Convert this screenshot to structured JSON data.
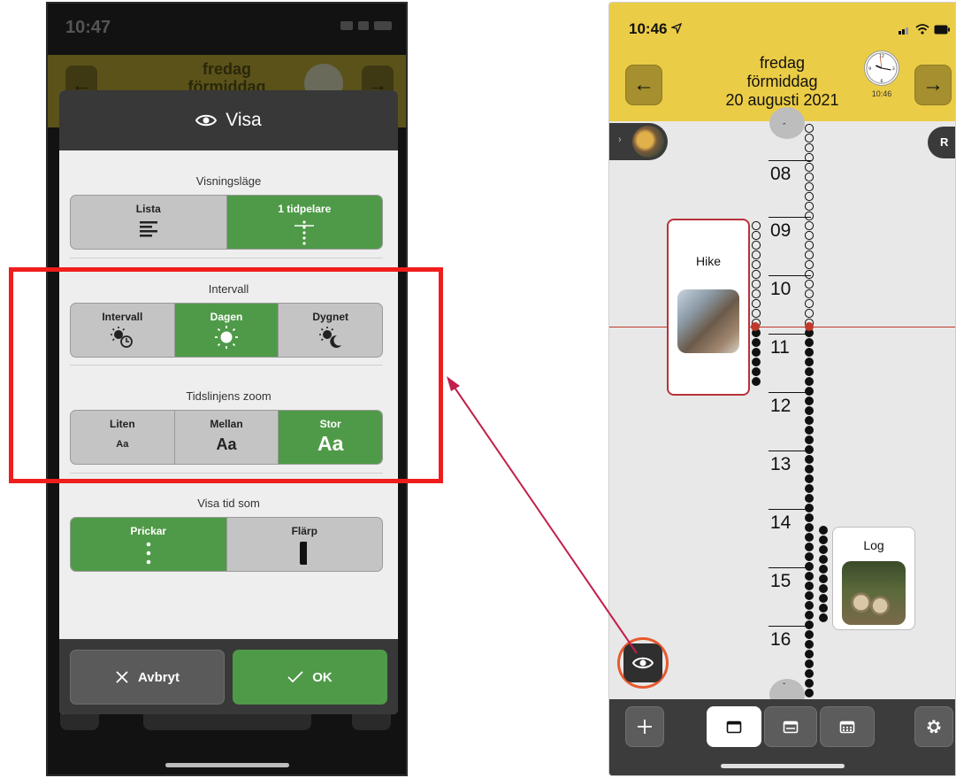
{
  "left_phone": {
    "status_time": "10:47",
    "header_title_line1": "fredag",
    "header_title_line2": "förmiddag",
    "dialog": {
      "title": "Visa",
      "title_icon": "eye-icon",
      "sections": [
        {
          "title": "Visningsläge",
          "options": [
            {
              "label": "Lista",
              "icon": "list-icon",
              "active": false
            },
            {
              "label": "1 tidpelare",
              "icon": "timepillar-icon",
              "active": true
            }
          ]
        },
        {
          "title": "Intervall",
          "options": [
            {
              "label": "Intervall",
              "icon": "sun-clock-icon",
              "active": false
            },
            {
              "label": "Dagen",
              "icon": "sun-icon",
              "active": true
            },
            {
              "label": "Dygnet",
              "icon": "sun-moon-icon",
              "active": false
            }
          ]
        },
        {
          "title": "Tidslinjens zoom",
          "options": [
            {
              "label": "Liten",
              "sample": "Aa",
              "active": false
            },
            {
              "label": "Mellan",
              "sample": "Aa",
              "active": false
            },
            {
              "label": "Stor",
              "sample": "Aa",
              "active": true
            }
          ]
        },
        {
          "title": "Visa tid som",
          "options": [
            {
              "label": "Prickar",
              "icon": "dots-icon",
              "active": true
            },
            {
              "label": "Flärp",
              "icon": "flap-icon",
              "active": false
            }
          ]
        }
      ],
      "cancel_label": "Avbryt",
      "ok_label": "OK"
    }
  },
  "right_phone": {
    "status_time": "10:46",
    "header": {
      "line1": "fredag",
      "line2": "förmiddag",
      "line3": "20 augusti 2021",
      "clock_time": "10:46"
    },
    "avatar_badge": "R",
    "hours": [
      "08",
      "09",
      "10",
      "11",
      "12",
      "13",
      "14",
      "15",
      "16"
    ],
    "events": [
      {
        "title": "Hike"
      },
      {
        "title": "Log"
      }
    ]
  },
  "colors": {
    "accent_green": "#4f9a48",
    "header_yellow": "#ebcc46",
    "highlight_red": "#f01d1d",
    "now_line": "#c0392b"
  }
}
